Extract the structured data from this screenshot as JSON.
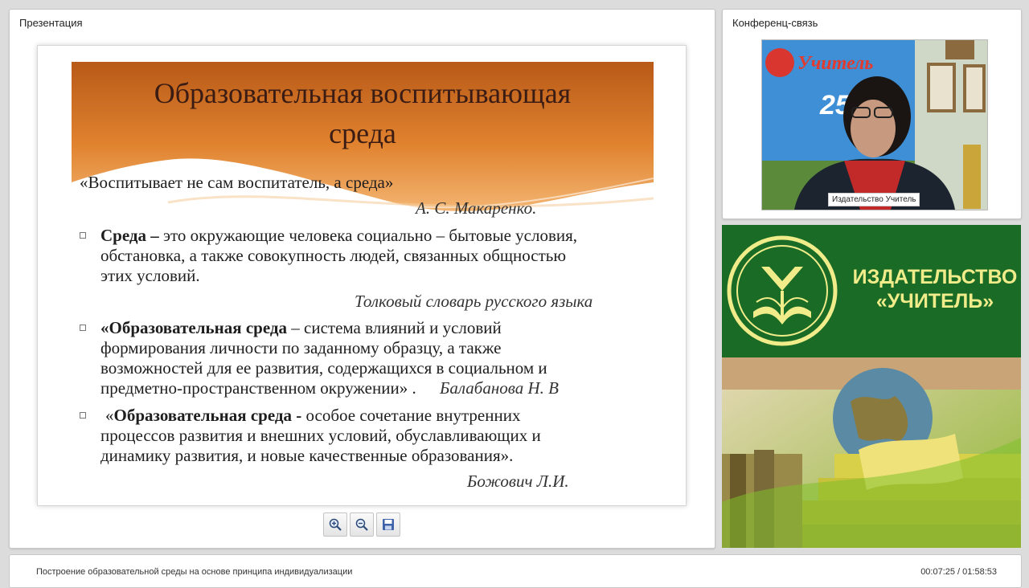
{
  "presentation": {
    "panel_title": "Презентация",
    "slide": {
      "title_line1": "Образовательная воспитывающая",
      "title_line2": "среда",
      "quote": "«Воспитывает не сам воспитатель, а среда»",
      "quote_author": "А. С. Макаренко.",
      "bullets": [
        {
          "term": "Среда –",
          "lines": [
            " это окружающие человека социально – бытовые условия,",
            "обстановка, а также совокупность людей, связанных общностью",
            "этих условий."
          ],
          "source": "Толковый словарь русского языка"
        },
        {
          "term": "«Образовательная среда",
          "lines": [
            " – система влияний и условий",
            "формирования личности по заданному образцу, а также",
            "возможностей для ее развития, содержащихся в социальном и",
            "предметно-пространственном окружении» .   "
          ],
          "source": "Балабанова Н. В"
        },
        {
          "term": "Образовательная среда -",
          "lines": [
            " особое сочетание внутренних",
            "процессов развития и внешних условий, обуславливающих и",
            "динамику развития, и новые качественные образования»."
          ],
          "prefix": "«",
          "source": "Божович Л.И."
        }
      ]
    },
    "toolbar": [
      {
        "name": "zoom-in-button",
        "icon": "zoom-in-icon"
      },
      {
        "name": "zoom-out-button",
        "icon": "zoom-out-icon"
      },
      {
        "name": "save-button",
        "icon": "floppy-disk-icon"
      }
    ]
  },
  "conference": {
    "panel_title": "Конференц-связь",
    "participant_name": "Издательство Учитель",
    "video_backdrop_text": "Учитель",
    "video_backdrop_number": "25"
  },
  "promo": {
    "line1": "ИЗДАТЕЛЬСТВО",
    "line2": "«УЧИТЕЛЬ»"
  },
  "footer": {
    "lecture_title": "Построение образовательной среды на основе принципа индивидуализации",
    "time": "00:07:25 / 01:58:53"
  },
  "colors": {
    "banner_orange": "#d9772a",
    "promo_green": "#1a6b26",
    "promo_text": "#f1ec8a"
  }
}
